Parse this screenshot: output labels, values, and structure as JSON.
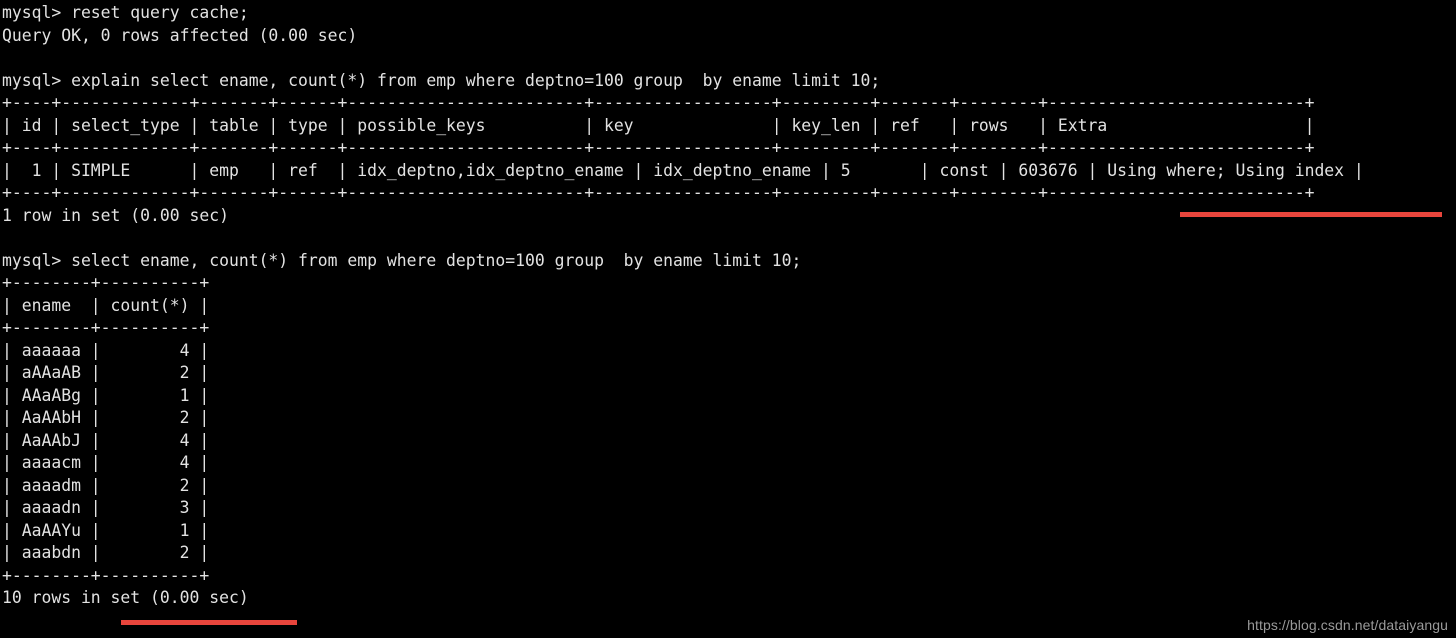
{
  "terminal": {
    "background_color": "#000000",
    "text_color": "#e2e2e2",
    "highlight_color": "#e8453c",
    "lines": [
      "mysql> reset query cache;",
      "Query OK, 0 rows affected (0.00 sec)",
      "",
      "mysql> explain select ename, count(*) from emp where deptno=100 group  by ename limit 10;",
      "+----+-------------+-------+------+------------------------+------------------+---------+-------+--------+--------------------------+",
      "| id | select_type | table | type | possible_keys          | key              | key_len | ref   | rows   | Extra                    |",
      "+----+-------------+-------+------+------------------------+------------------+---------+-------+--------+--------------------------+",
      "|  1 | SIMPLE      | emp   | ref  | idx_deptno,idx_deptno_ename | idx_deptno_ename | 5       | const | 603676 | Using where; Using index |",
      "+----+-------------+-------+------+------------------------+------------------+---------+-------+--------+--------------------------+",
      "1 row in set (0.00 sec)",
      "",
      "mysql> select ename, count(*) from emp where deptno=100 group  by ename limit 10;",
      "+--------+----------+",
      "| ename  | count(*) |",
      "+--------+----------+",
      "| aaaaaa |        4 |",
      "| aAAaAB |        2 |",
      "| AAaABg |        1 |",
      "| AaAAbH |        2 |",
      "| AaAAbJ |        4 |",
      "| aaaacm |        4 |",
      "| aaaadm |        2 |",
      "| aaaadn |        3 |",
      "| AaAAYu |        1 |",
      "| aaabdn |        2 |",
      "+--------+----------+",
      "10 rows in set (0.00 sec)"
    ],
    "prompt": "mysql>",
    "commands": [
      "reset query cache;",
      "explain select ename, count(*) from emp where deptno=100 group  by ename limit 10;",
      "select ename, count(*) from emp where deptno=100 group  by ename limit 10;"
    ],
    "status_messages": [
      "Query OK, 0 rows affected (0.00 sec)",
      "1 row in set (0.00 sec)",
      "10 rows in set (0.00 sec)"
    ]
  },
  "explain_table": {
    "columns": [
      "id",
      "select_type",
      "table",
      "type",
      "possible_keys",
      "key",
      "key_len",
      "ref",
      "rows",
      "Extra"
    ],
    "rows": [
      {
        "id": "1",
        "select_type": "SIMPLE",
        "table": "emp",
        "type": "ref",
        "possible_keys": "idx_deptno,idx_deptno_ename",
        "key": "idx_deptno_ename",
        "key_len": "5",
        "ref": "const",
        "rows": "603676",
        "Extra": "Using where; Using index"
      }
    ]
  },
  "result_table": {
    "columns": [
      "ename",
      "count(*)"
    ],
    "rows": [
      {
        "ename": "aaaaaa",
        "count": "4"
      },
      {
        "ename": "aAAaAB",
        "count": "2"
      },
      {
        "ename": "AAaABg",
        "count": "1"
      },
      {
        "ename": "AaAAbH",
        "count": "2"
      },
      {
        "ename": "AaAAbJ",
        "count": "4"
      },
      {
        "ename": "aaaacm",
        "count": "4"
      },
      {
        "ename": "aaaadm",
        "count": "2"
      },
      {
        "ename": "aaaadn",
        "count": "3"
      },
      {
        "ename": "AaAAYu",
        "count": "1"
      },
      {
        "ename": "aaabdn",
        "count": "2"
      }
    ]
  },
  "annotations": [
    {
      "name": "extra-column-underline",
      "color": "#e8453c",
      "targets": "Using where; Using index"
    },
    {
      "name": "rows-in-set-underline",
      "color": "#e8453c",
      "targets": "10 rows in set (0.00 sec)"
    }
  ],
  "watermark": {
    "text": "https://blog.csdn.net/dataiyangu"
  }
}
